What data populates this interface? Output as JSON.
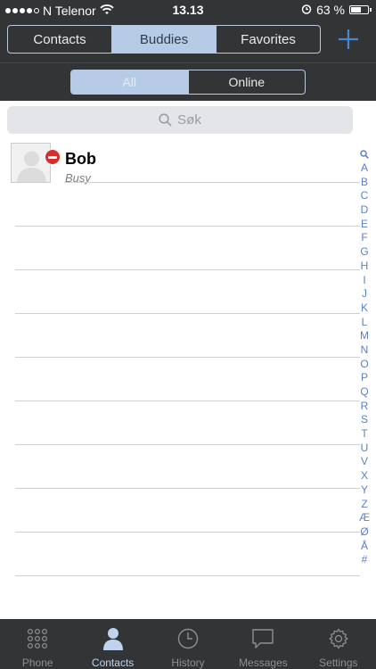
{
  "status_bar": {
    "carrier": "N Telenor",
    "time": "13.13",
    "battery_percent": "63 %",
    "battery_level": 0.63,
    "signal_bars": 4
  },
  "nav": {
    "tabs": [
      {
        "label": "Contacts",
        "active": false
      },
      {
        "label": "Buddies",
        "active": true
      },
      {
        "label": "Favorites",
        "active": false
      }
    ],
    "add_icon": "plus-icon"
  },
  "filter": {
    "options": [
      {
        "label": "All",
        "active": true
      },
      {
        "label": "Online",
        "active": false
      }
    ]
  },
  "search": {
    "placeholder": "Søk",
    "icon": "search-icon"
  },
  "buddies": [
    {
      "name": "Bob",
      "presence": "Busy",
      "status_icon": "do-not-disturb-icon"
    }
  ],
  "index_letters": [
    "A",
    "B",
    "C",
    "D",
    "E",
    "F",
    "G",
    "H",
    "I",
    "J",
    "K",
    "L",
    "M",
    "N",
    "O",
    "P",
    "Q",
    "R",
    "S",
    "T",
    "U",
    "V",
    "X",
    "Y",
    "Z",
    "Æ",
    "Ø",
    "Å",
    "#"
  ],
  "tab_bar": {
    "items": [
      {
        "label": "Phone",
        "icon": "keypad-icon",
        "active": false
      },
      {
        "label": "Contacts",
        "icon": "person-icon",
        "active": true
      },
      {
        "label": "History",
        "icon": "clock-icon",
        "active": false
      },
      {
        "label": "Messages",
        "icon": "chat-bubble-icon",
        "active": false
      },
      {
        "label": "Settings",
        "icon": "gear-icon",
        "active": false
      }
    ]
  },
  "colors": {
    "bar_background": "#333436",
    "accent": "#b6cbe6",
    "busy_red": "#d32f2f",
    "index_blue": "#5b82c8"
  }
}
